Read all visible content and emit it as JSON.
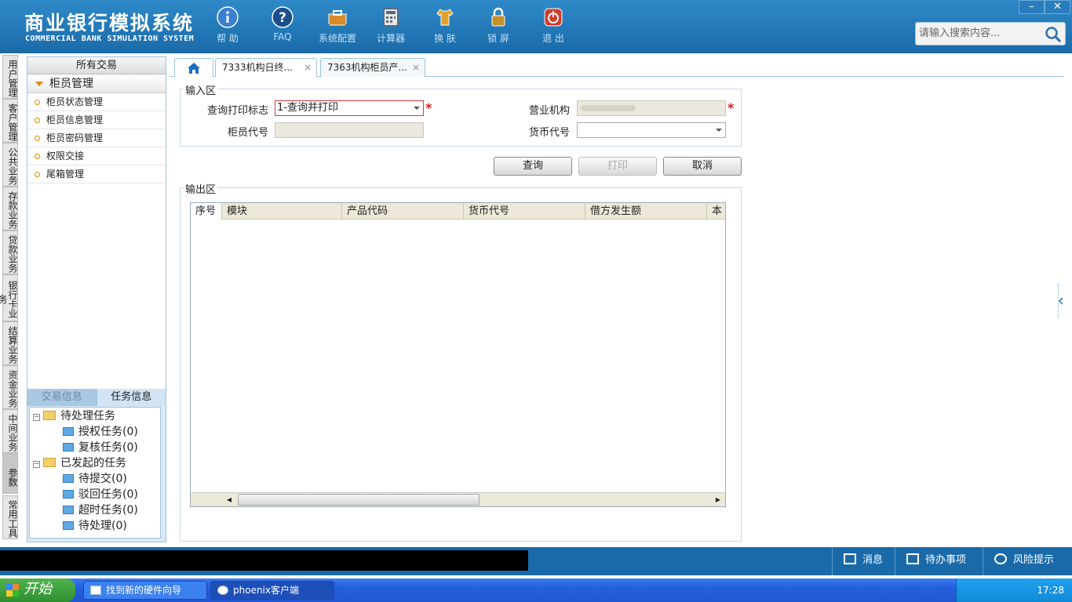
{
  "app": {
    "title_cn": "商业银行模拟系统",
    "title_en": "COMMERCIAL BANK SIMULATION SYSTEM"
  },
  "toolbar": [
    {
      "label": "帮 助",
      "icon": "info-icon",
      "color": "#3a7fd0"
    },
    {
      "label": "FAQ",
      "icon": "question-icon",
      "color": "#1c4f8c"
    },
    {
      "label": "系统配置",
      "icon": "toolbox-icon",
      "color": "#d88b2a"
    },
    {
      "label": "计算器",
      "icon": "calculator-icon",
      "color": "#5a6a7a"
    },
    {
      "label": "换 肤",
      "icon": "shirt-icon",
      "color": "#e0a22a"
    },
    {
      "label": "锁 屏",
      "icon": "lock-icon",
      "color": "#c7902a"
    },
    {
      "label": "退 出",
      "icon": "power-icon",
      "color": "#d33b2a"
    }
  ],
  "window": {
    "minimize": "–",
    "close": "✕"
  },
  "search": {
    "placeholder": "请输入搜索内容..."
  },
  "vnav": [
    "用户管理",
    "客户管理",
    "公共业务",
    "存款业务",
    "贷款业务",
    "银行卡业务",
    "结算业务",
    "资金业务",
    "中间业务",
    "参数",
    "常用工具"
  ],
  "left_panel": {
    "title": "所有交易",
    "group": "柜员管理",
    "items": [
      "柜员状态管理",
      "柜员信息管理",
      "柜员密码管理",
      "权限交接",
      "尾箱管理"
    ],
    "tabs": [
      "交易信息",
      "任务信息"
    ],
    "tree": {
      "pending": "待处理任务",
      "pending_children": [
        "授权任务(0)",
        "复核任务(0)"
      ],
      "initiated": "已发起的任务",
      "initiated_children": [
        "待提交(0)",
        "驳回任务(0)",
        "超时任务(0)",
        "待处理(0)"
      ]
    }
  },
  "tabs": [
    "7333机构日终...",
    "7363机构柜员产..."
  ],
  "input_area": {
    "legend": "输入区",
    "print_flag_label": "查询打印标志",
    "print_flag_value": "1-查询并打印",
    "branch_label": "营业机构",
    "teller_label": "柜员代号",
    "currency_label": "货币代号",
    "required": "*"
  },
  "buttons": {
    "query": "查询",
    "print": "打印",
    "cancel": "取消"
  },
  "output_area": {
    "legend": "输出区",
    "columns": [
      "序号",
      "模块",
      "产品代码",
      "货币代号",
      "借方发生额",
      "本"
    ]
  },
  "footer": {
    "message": "消息",
    "todo": "待办事项",
    "risk": "风险提示"
  },
  "taskbar": {
    "start": "开始",
    "tasks": [
      "找到新的硬件向导",
      "phoenix客户端"
    ],
    "clock": "17:28"
  }
}
